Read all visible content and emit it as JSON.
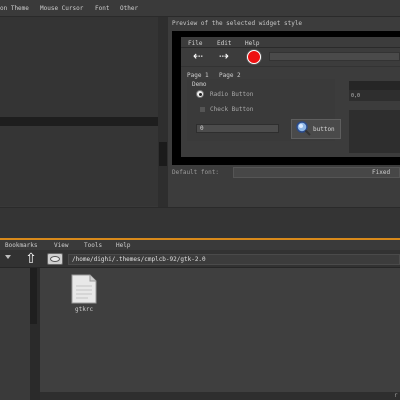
{
  "top_window": {
    "menu": [
      "on Theme",
      "Mouse Cursor",
      "Font",
      "Other"
    ],
    "preview_label": "Preview of the selected widget style",
    "default_font_label": "Default font:",
    "default_font_value": "Fixed"
  },
  "preview": {
    "menu": [
      "File",
      "Edit",
      "Help"
    ],
    "tabs": [
      "Page 1",
      "Page 2"
    ],
    "demo_label": "Demo",
    "radio_label": "Radio Button",
    "radio_checked": true,
    "check_label": "Check Button",
    "check_checked": false,
    "spin_value": "0",
    "button_label": "button",
    "right_value": "0,0"
  },
  "file_manager": {
    "menu": [
      "Bookmarks",
      "View",
      "Tools",
      "Help"
    ],
    "path": "/home/dighi/.themes/cmplcb-92/gtk-2.0",
    "files": [
      {
        "name": "gtkrc",
        "icon": "text-file-icon"
      }
    ],
    "status_right": "r"
  },
  "colors": {
    "accent_divider": "#d98a1b",
    "stop_button": "#e11111"
  }
}
